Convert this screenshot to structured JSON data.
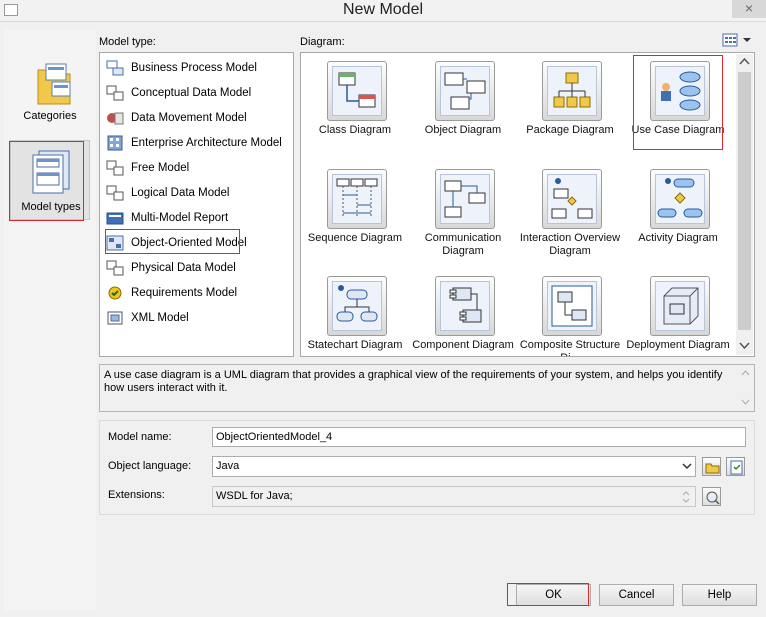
{
  "window": {
    "title": "New Model",
    "close_glyph": "×"
  },
  "categories": [
    {
      "label": "Categories",
      "icon": "categories-folder-icon",
      "selected": false
    },
    {
      "label": "Model types",
      "icon": "model-types-icon",
      "selected": true
    }
  ],
  "model_type_label": "Model type:",
  "model_types": [
    {
      "label": "Business Process Model",
      "icon": "business-process-model-icon"
    },
    {
      "label": "Conceptual Data Model",
      "icon": "conceptual-data-model-icon"
    },
    {
      "label": "Data Movement Model",
      "icon": "data-movement-model-icon"
    },
    {
      "label": "Enterprise Architecture Model",
      "icon": "enterprise-architecture-model-icon"
    },
    {
      "label": "Free Model",
      "icon": "free-model-icon"
    },
    {
      "label": "Logical Data Model",
      "icon": "logical-data-model-icon"
    },
    {
      "label": "Multi-Model Report",
      "icon": "multi-model-report-icon"
    },
    {
      "label": "Object-Oriented Model",
      "icon": "object-oriented-model-icon",
      "selected": true
    },
    {
      "label": "Physical Data Model",
      "icon": "physical-data-model-icon"
    },
    {
      "label": "Requirements Model",
      "icon": "requirements-model-icon"
    },
    {
      "label": "XML Model",
      "icon": "xml-model-icon"
    }
  ],
  "diagram_label": "Diagram:",
  "diagrams": [
    {
      "label": "Class Diagram",
      "icon": "class-diagram-icon"
    },
    {
      "label": "Object Diagram",
      "icon": "object-diagram-icon"
    },
    {
      "label": "Package Diagram",
      "icon": "package-diagram-icon"
    },
    {
      "label": "Use Case Diagram",
      "icon": "use-case-diagram-icon",
      "selected": true
    },
    {
      "label": "Sequence Diagram",
      "icon": "sequence-diagram-icon"
    },
    {
      "label": "Communication Diagram",
      "icon": "communication-diagram-icon"
    },
    {
      "label": "Interaction Overview Diagram",
      "icon": "interaction-overview-diagram-icon"
    },
    {
      "label": "Activity Diagram",
      "icon": "activity-diagram-icon"
    },
    {
      "label": "Statechart Diagram",
      "icon": "statechart-diagram-icon"
    },
    {
      "label": "Component Diagram",
      "icon": "component-diagram-icon"
    },
    {
      "label": "Composite Structure Di...",
      "icon": "composite-structure-diagram-icon"
    },
    {
      "label": "Deployment Diagram",
      "icon": "deployment-diagram-icon"
    }
  ],
  "description": "A use case diagram is a UML diagram that provides a graphical view of the requirements of your system, and helps you identify how users interact with it.",
  "form": {
    "model_name_label": "Model name:",
    "model_name_value": "ObjectOrientedModel_4",
    "object_language_label": "Object language:",
    "object_language_value": "Java",
    "extensions_label": "Extensions:",
    "extensions_value": "WSDL for Java;"
  },
  "buttons": {
    "ok": "OK",
    "cancel": "Cancel",
    "help": "Help"
  },
  "colors": {
    "highlight_red": "#e0262b",
    "selection_bg": "#e3e3e3"
  }
}
